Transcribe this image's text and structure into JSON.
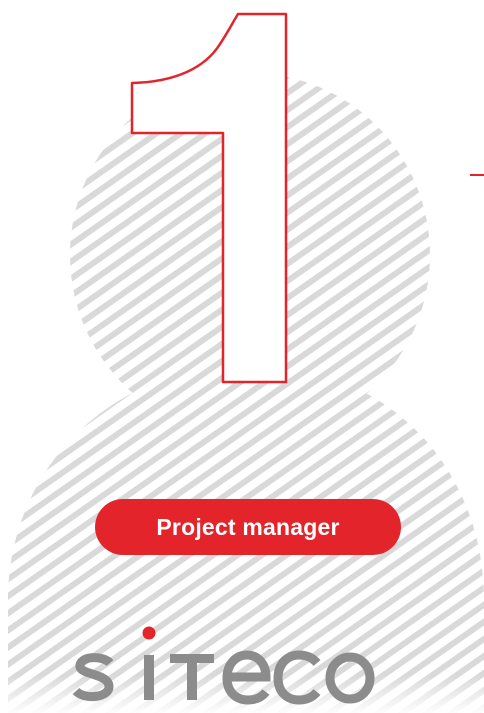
{
  "role_badge": {
    "label": "Project manager"
  },
  "logo": {
    "wordmark": "siteco",
    "dot_color": "#e3242b",
    "text_color": "#8c8c8c"
  },
  "illustration": {
    "numeral": "1",
    "numeral_stroke_color": "#e3242b",
    "stripe_color": "#d9d9d9",
    "accent_dash_color": "#e3242b"
  }
}
